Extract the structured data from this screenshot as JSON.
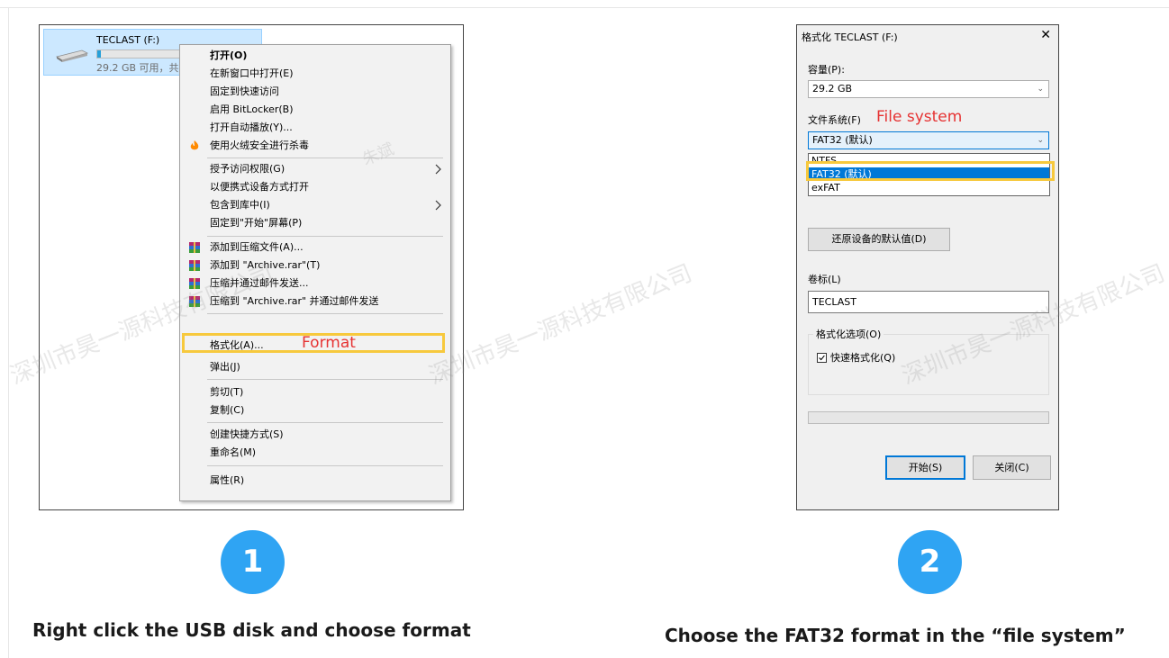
{
  "step1": {
    "number": "1",
    "caption": "Right click the USB disk and choose format",
    "annotation": "Format",
    "drive": {
      "name": "TECLAST (F:)",
      "info": "29.2 GB 可用，共"
    },
    "menu_items": [
      {
        "label": "打开(O)",
        "bold": true
      },
      {
        "label": "在新窗口中打开(E)"
      },
      {
        "label": "固定到快速访问"
      },
      {
        "label": "启用 BitLocker(B)"
      },
      {
        "label": "打开自动播放(Y)..."
      },
      {
        "label": "使用火绒安全进行杀毒",
        "icon": "huorong-icon"
      },
      {
        "label": "授予访问权限(G)",
        "submenu": true
      },
      {
        "label": "以便携式设备方式打开"
      },
      {
        "label": "包含到库中(I)",
        "submenu": true
      },
      {
        "label": "固定到\"开始\"屏幕(P)"
      },
      {
        "label": "添加到压缩文件(A)...",
        "icon": "winrar-icon"
      },
      {
        "label": "添加到 \"Archive.rar\"(T)",
        "icon": "winrar-icon"
      },
      {
        "label": "压缩并通过邮件发送...",
        "icon": "winrar-icon"
      },
      {
        "label": "压缩到 \"Archive.rar\" 并通过邮件发送",
        "icon": "winrar-icon"
      },
      {
        "label": "格式化(A)..."
      },
      {
        "label": "弹出(J)"
      },
      {
        "label": "剪切(T)"
      },
      {
        "label": "复制(C)"
      },
      {
        "label": "创建快捷方式(S)"
      },
      {
        "label": "重命名(M)"
      },
      {
        "label": "属性(R)"
      }
    ]
  },
  "step2": {
    "number": "2",
    "caption": "Choose the FAT32 format in the “file system”",
    "annotation": "File system",
    "dialog": {
      "title": "格式化 TECLAST (F:)",
      "close": "✕",
      "capacity_label": "容量(P):",
      "capacity_value": "29.2 GB",
      "filesystem_label": "文件系统(F)",
      "filesystem_value": "FAT32 (默认)",
      "filesystem_options": [
        "NTFS",
        "FAT32 (默认)",
        "exFAT"
      ],
      "restore_button": "还原设备的默认值(D)",
      "volume_label": "卷标(L)",
      "volume_value": "TECLAST",
      "options_label": "格式化选项(O)",
      "quick_format_label": "快速格式化(Q)",
      "quick_format_checked": true,
      "start_button": "开始(S)",
      "close_button": "关闭(C)"
    }
  },
  "watermark": {
    "text": "深圳市昊一源科技有限公司",
    "name": "朱斌"
  }
}
